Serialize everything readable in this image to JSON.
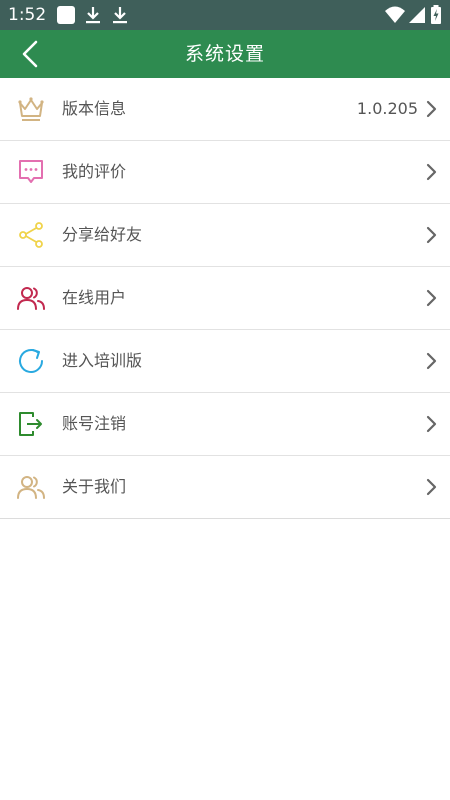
{
  "status_bar": {
    "time": "1:52",
    "icons": [
      "square-notification-icon",
      "download-icon",
      "download-icon",
      "wifi-icon",
      "signal-icon",
      "battery-charging-icon"
    ]
  },
  "header": {
    "title": "系统设置",
    "back_icon": "chevron-left-icon",
    "background_color": "#2e8b50"
  },
  "settings": {
    "items": [
      {
        "label": "版本信息",
        "value": "1.0.205",
        "icon": "crown-icon",
        "icon_color": "#d2b483"
      },
      {
        "label": "我的评价",
        "icon": "comment-icon",
        "icon_color": "#e36fb0"
      },
      {
        "label": "分享给好友",
        "icon": "share-icon",
        "icon_color": "#f0d34a"
      },
      {
        "label": "在线用户",
        "icon": "users-icon",
        "icon_color": "#c2294f"
      },
      {
        "label": "进入培训版",
        "icon": "refresh-icon",
        "icon_color": "#29a9e0"
      },
      {
        "label": "账号注销",
        "icon": "logout-icon",
        "icon_color": "#2e8b2e"
      },
      {
        "label": "关于我们",
        "icon": "users-icon",
        "icon_color": "#d2b483"
      }
    ]
  }
}
